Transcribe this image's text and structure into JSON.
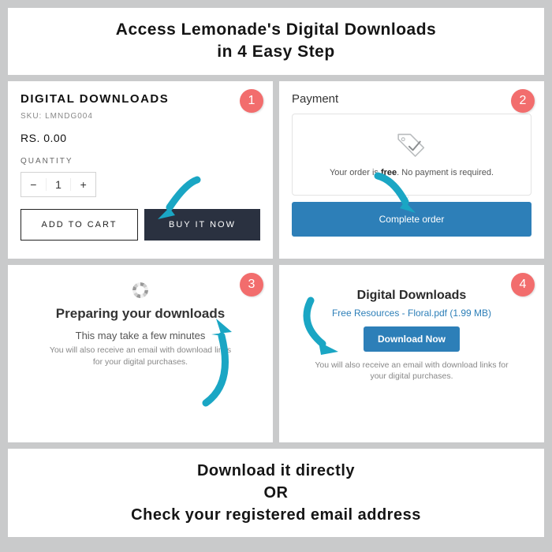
{
  "header": {
    "line1": "Access Lemonade's Digital Downloads",
    "line2": "in 4 Easy Step"
  },
  "steps": {
    "s1": {
      "num": "1",
      "title": "DIGITAL DOWNLOADS",
      "sku": "SKU: LMNDG004",
      "price": "RS. 0.00",
      "qty_label": "QUANTITY",
      "qty_value": "1",
      "add_label": "ADD TO CART",
      "buy_label": "BUY IT NOW"
    },
    "s2": {
      "num": "2",
      "title": "Payment",
      "free_prefix": "Your order is ",
      "free_bold": "free",
      "free_suffix": ". No payment is required.",
      "complete_label": "Complete order"
    },
    "s3": {
      "num": "3",
      "title": "Preparing your downloads",
      "sub": "This may take a few minutes",
      "note": "You will also receive an email with download links for your digital purchases."
    },
    "s4": {
      "num": "4",
      "title": "Digital Downloads",
      "file": "Free Resources - Floral.pdf (1.99 MB)",
      "download_label": "Download Now",
      "note": "You will also receive an email with download links for your digital purchases."
    }
  },
  "footer": {
    "line1": "Download it directly",
    "line2": "OR",
    "line3": "Check your registered email address"
  }
}
